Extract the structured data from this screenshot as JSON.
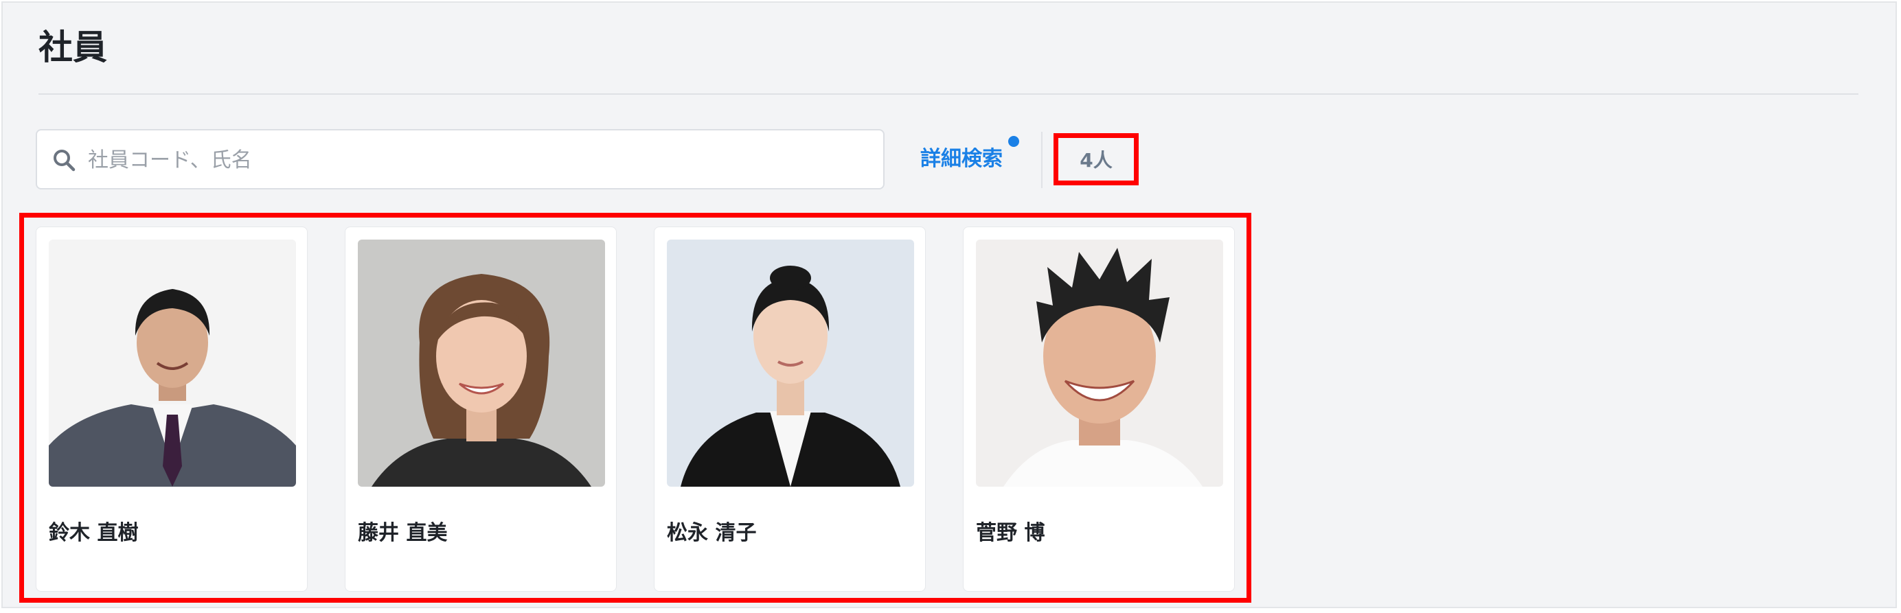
{
  "page": {
    "title": "社員"
  },
  "search": {
    "placeholder": "社員コード、氏名",
    "value": ""
  },
  "advanced_search": {
    "label": "詳細検索"
  },
  "count": {
    "label": "4人"
  },
  "employees": [
    {
      "name": "鈴木 直樹"
    },
    {
      "name": "藤井 直美"
    },
    {
      "name": "松永 清子"
    },
    {
      "name": "菅野 博"
    }
  ],
  "colors": {
    "accent": "#1a80e6",
    "highlight": "#ff0000",
    "background": "#f3f4f6"
  }
}
